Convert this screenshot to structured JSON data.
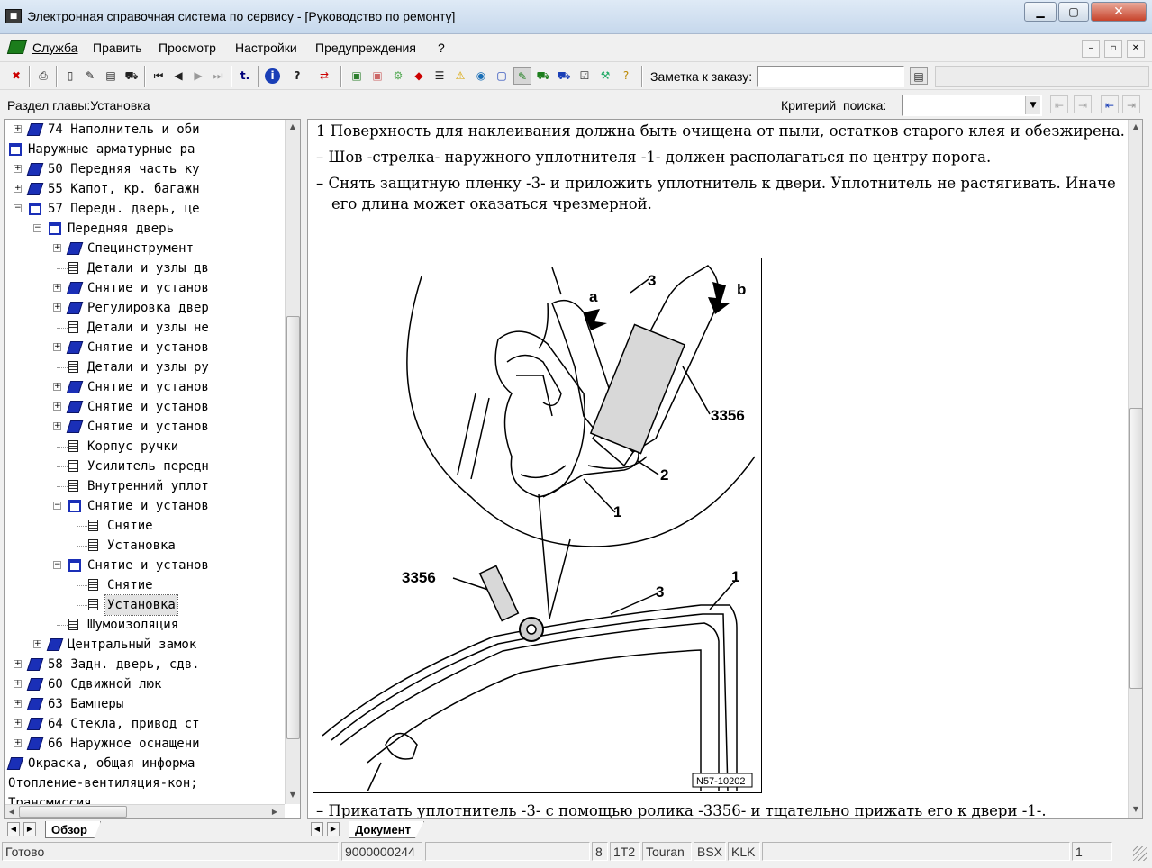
{
  "window": {
    "title": "Электронная справочная система по сервису - [Руководство по ремонту]"
  },
  "menu": [
    "Служба",
    "Править",
    "Просмотр",
    "Настройки",
    "Предупреждения",
    "?"
  ],
  "toolbar": {
    "note_label": "Заметка к заказу:"
  },
  "infobar": {
    "chapter_section": "Раздел главы:Установка",
    "search_label": "Критерий  поиска:",
    "search_value": ""
  },
  "tree": {
    "items": [
      {
        "label": "74 Наполнитель и оби",
        "level": 3,
        "icon": "book",
        "expander": "+"
      },
      {
        "label": "Наружные арматурные ра",
        "level": 2,
        "icon": "open-book",
        "expander": "-"
      },
      {
        "label": "50 Передняя часть ку",
        "level": 3,
        "icon": "book",
        "expander": "+"
      },
      {
        "label": "55 Капот, кр. багажн",
        "level": 3,
        "icon": "book",
        "expander": "+"
      },
      {
        "label": "57 Передн. дверь, це",
        "level": 3,
        "icon": "open-book",
        "expander": "-"
      },
      {
        "label": "Передняя дверь",
        "level": 4,
        "icon": "open-book",
        "expander": "-"
      },
      {
        "label": "Специнструмент",
        "level": 5,
        "icon": "book",
        "expander": "+"
      },
      {
        "label": "Детали и узлы дв",
        "level": 5,
        "icon": "page",
        "expander": ""
      },
      {
        "label": "Снятие и установ",
        "level": 5,
        "icon": "book",
        "expander": "+"
      },
      {
        "label": "Регулировка двер",
        "level": 5,
        "icon": "book",
        "expander": "+"
      },
      {
        "label": "Детали и узлы не",
        "level": 5,
        "icon": "page",
        "expander": ""
      },
      {
        "label": "Снятие и установ",
        "level": 5,
        "icon": "book",
        "expander": "+"
      },
      {
        "label": "Детали и узлы ру",
        "level": 5,
        "icon": "page",
        "expander": ""
      },
      {
        "label": "Снятие и установ",
        "level": 5,
        "icon": "book",
        "expander": "+"
      },
      {
        "label": "Снятие и установ",
        "level": 5,
        "icon": "book",
        "expander": "+"
      },
      {
        "label": "Снятие и установ",
        "level": 5,
        "icon": "book",
        "expander": "+"
      },
      {
        "label": "Корпус ручки",
        "level": 5,
        "icon": "page",
        "expander": ""
      },
      {
        "label": "Усилитель передн",
        "level": 5,
        "icon": "page",
        "expander": ""
      },
      {
        "label": "Внутренний уплот",
        "level": 5,
        "icon": "page",
        "expander": ""
      },
      {
        "label": "Снятие и установ",
        "level": 5,
        "icon": "open-book",
        "expander": "-"
      },
      {
        "label": "Снятие",
        "level": 6,
        "icon": "page",
        "expander": ""
      },
      {
        "label": "Установка",
        "level": 6,
        "icon": "page",
        "expander": ""
      },
      {
        "label": "Снятие и установ",
        "level": 5,
        "icon": "open-book",
        "expander": "-"
      },
      {
        "label": "Снятие",
        "level": 6,
        "icon": "page",
        "expander": ""
      },
      {
        "label": "Установка",
        "level": 6,
        "icon": "page",
        "expander": "",
        "selected": true
      },
      {
        "label": "Шумоизоляция",
        "level": 5,
        "icon": "page",
        "expander": ""
      },
      {
        "label": "Центральный замок",
        "level": 4,
        "icon": "book",
        "expander": "+"
      },
      {
        "label": "58 Задн. дверь, сдв.",
        "level": 3,
        "icon": "book",
        "expander": "+"
      },
      {
        "label": "60 Сдвижной люк",
        "level": 3,
        "icon": "book",
        "expander": "+"
      },
      {
        "label": "63 Бамперы",
        "level": 3,
        "icon": "book",
        "expander": "+"
      },
      {
        "label": "64 Стекла, привод ст",
        "level": 3,
        "icon": "book",
        "expander": "+"
      },
      {
        "label": "66 Наружное оснащени",
        "level": 3,
        "icon": "book",
        "expander": "+"
      },
      {
        "label": "Окраска, общая информа",
        "level": 2,
        "icon": "book",
        "expander": "+"
      },
      {
        "label": "Отопление-вентиляция-кон;",
        "level": 1,
        "icon": "book",
        "expander": "+"
      },
      {
        "label": "Трансмиссия",
        "level": 1,
        "icon": "book",
        "expander": "+"
      }
    ]
  },
  "tabs": {
    "overview": "Обзор",
    "document": "Документ"
  },
  "document": {
    "line1": "1 Поверхность для наклеивания должна быть очищена от пыли, остатков старого клея и обезжирена.",
    "bullet1": "–  Шов -стрелка- наружного уплотнителя -1- должен располагаться по центру порога.",
    "bullet2a": "–  Снять защитную пленку -3- и приложить уплотнитель к двери. Уплотнитель не растягивать. Иначе",
    "bullet2b": "его длина может оказаться чрезмерной.",
    "bullet3": "–  Прикатать уплотнитель -3- с помощью ролика -3356- и тщательно прижать его к двери -1-.",
    "figure": {
      "labels": {
        "a": "a",
        "b": "b",
        "three_top": "3",
        "tool_top": "3356",
        "two": "2",
        "one_top": "1",
        "tool_bottom": "3356",
        "three_bottom": "3",
        "one_bottom": "1"
      },
      "code": "N57-10202"
    }
  },
  "statusbar": {
    "status": "Готово",
    "order": "9000000244",
    "f1": "8",
    "f2": "1T2",
    "f3": "Touran",
    "f4": "BSX",
    "f5": "KLK",
    "page": "1"
  }
}
